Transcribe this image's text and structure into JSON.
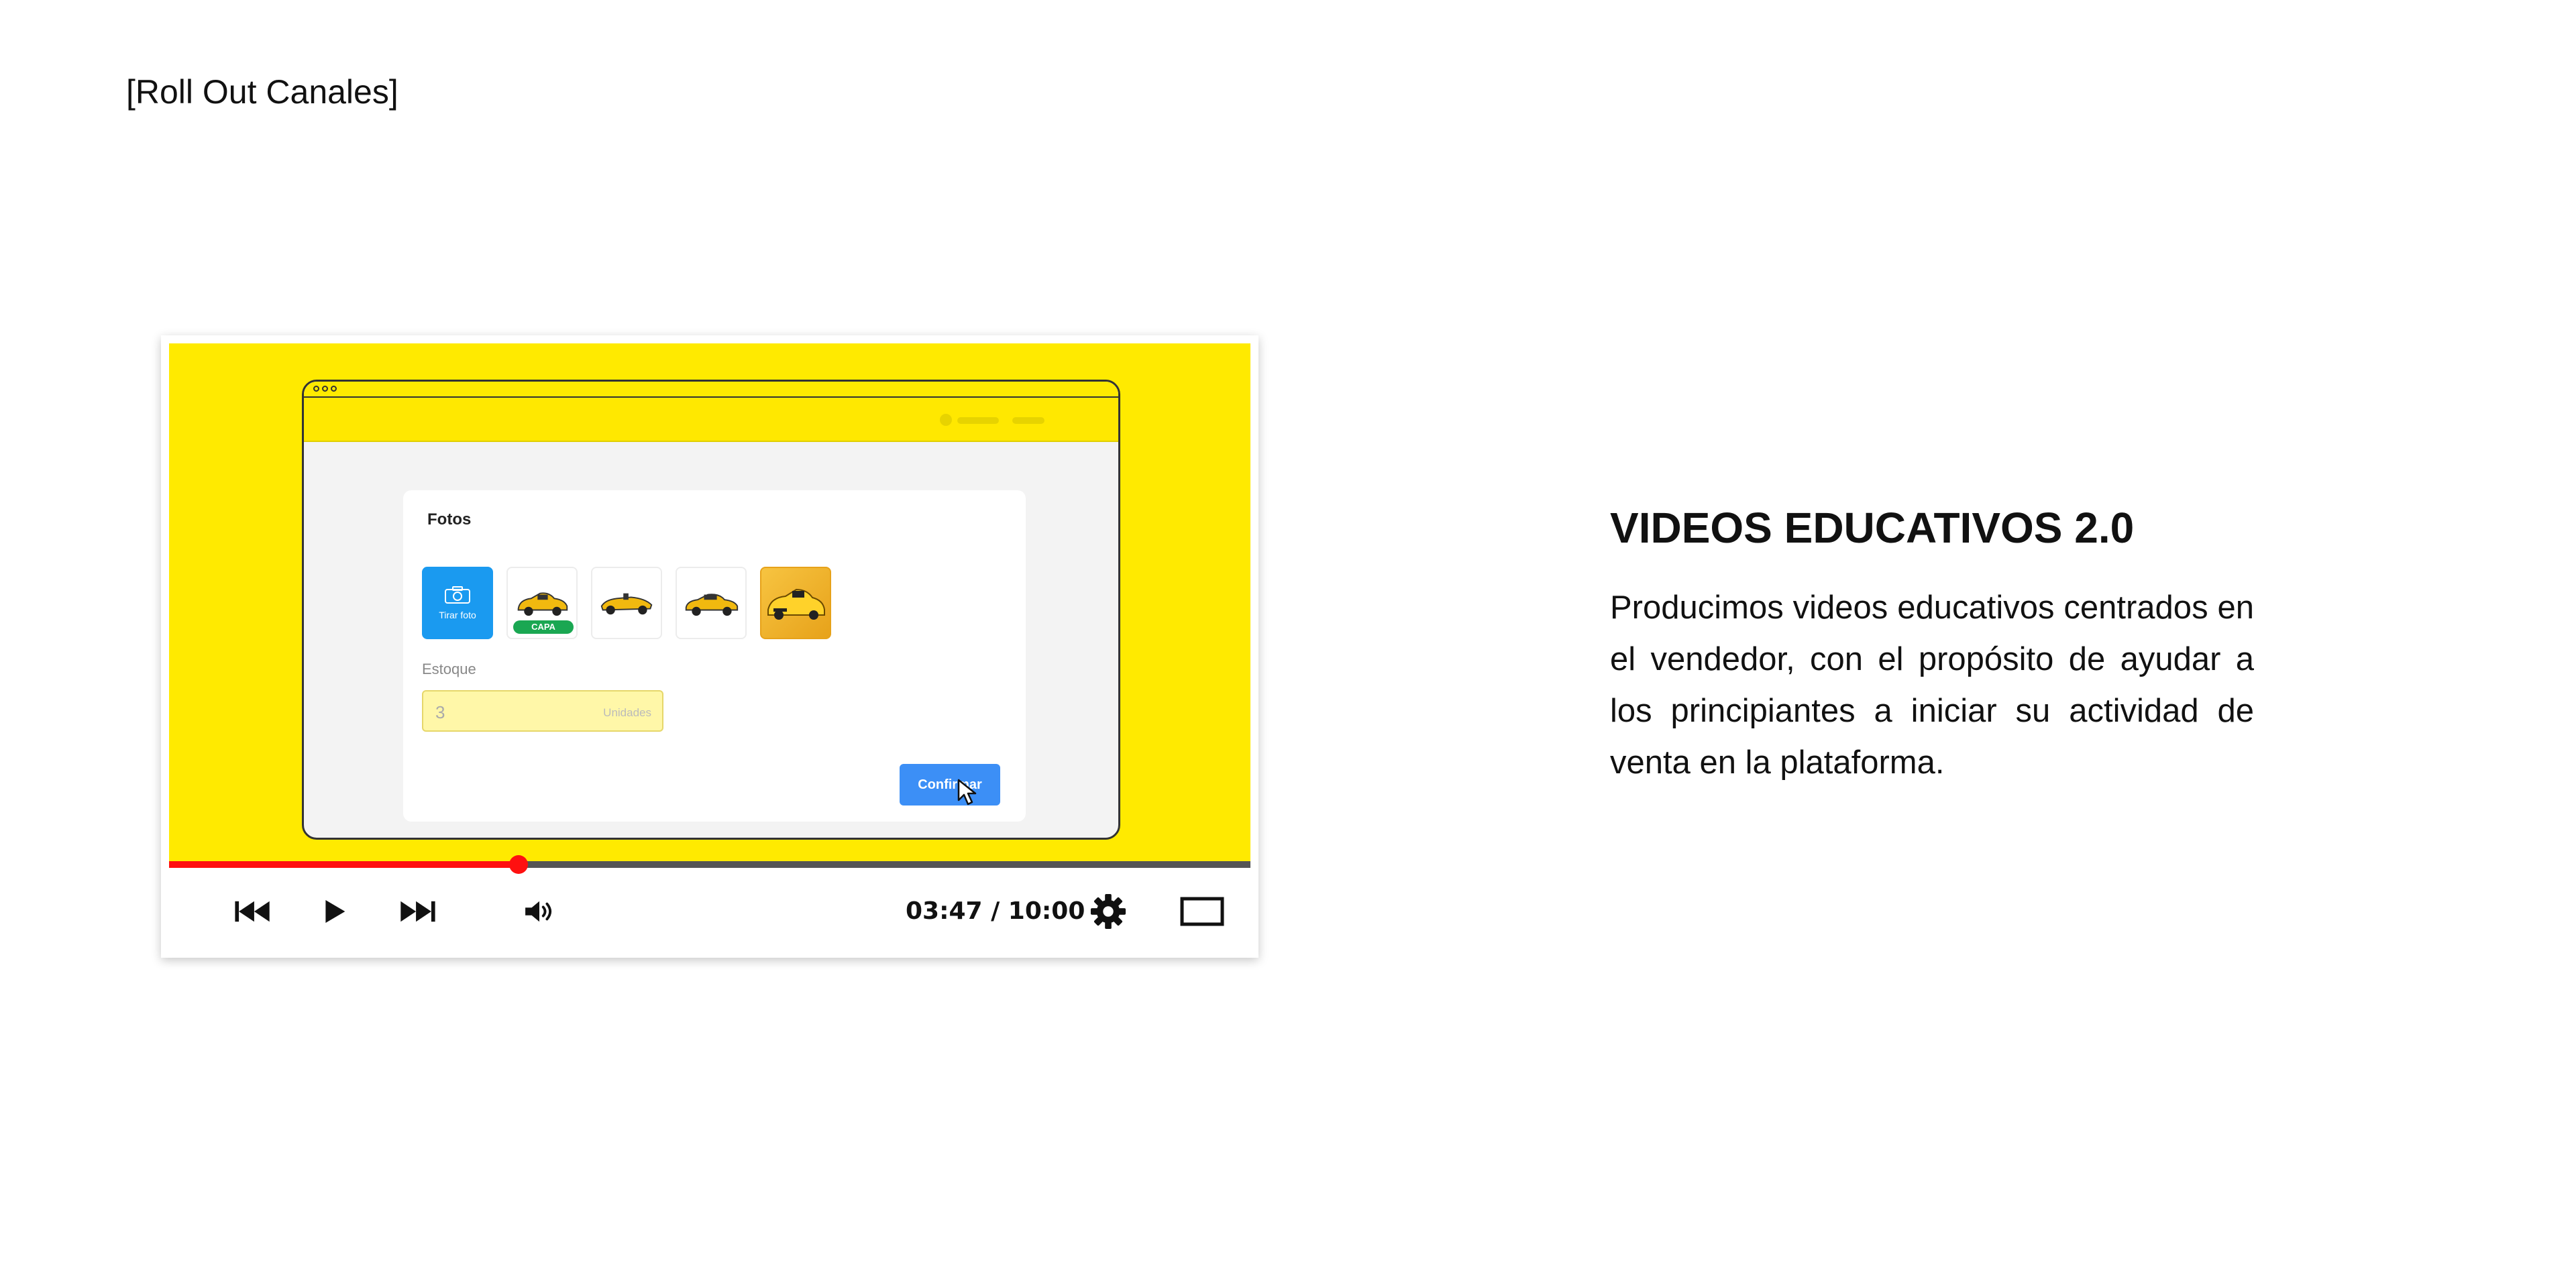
{
  "slide": {
    "label": "[Roll Out Canales]",
    "heading": "VIDEOS EDUCATIVOS 2.0",
    "description": "Producimos videos educativos centrados en el vendedor, con el propósito de ayudar a los principiantes a iniciar su actividad de venta en la plataforma."
  },
  "video_frame": {
    "background_color": "#ffea00",
    "card": {
      "title": "Fotos",
      "camera_tile_label": "Tirar foto",
      "cover_badge": "CAPA",
      "stock_label": "Estoque",
      "stock_value": "3",
      "stock_unit": "Unidades",
      "confirm_label": "Confirmar"
    }
  },
  "player": {
    "progress": 0.3233,
    "progress_color": "#ff1010",
    "time_display": "03:47 / 10:00",
    "controls": [
      "skip-back-icon",
      "play-icon",
      "skip-forward-icon",
      "volume-icon",
      "settings-gear-icon",
      "theater-mode-icon"
    ]
  }
}
